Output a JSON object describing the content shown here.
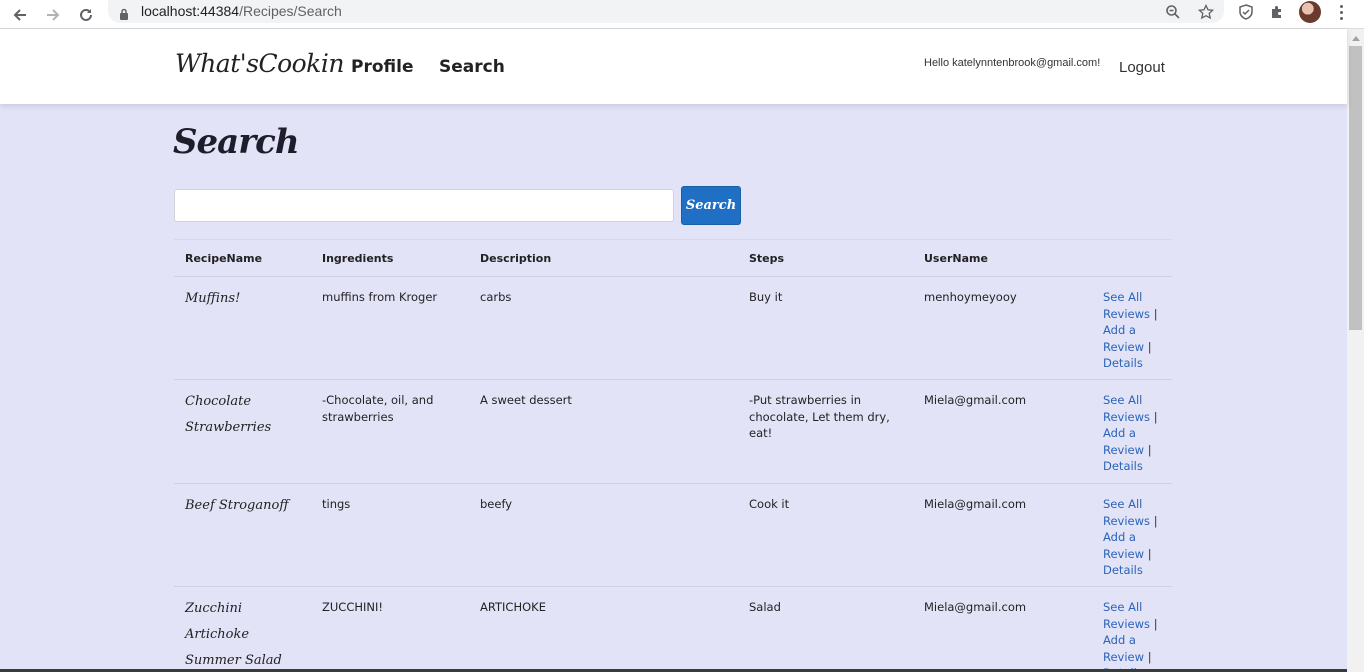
{
  "browser": {
    "url_host": "localhost:44384",
    "url_path": "/Recipes/Search"
  },
  "nav": {
    "brand": "What'sCookin",
    "links": [
      "Profile",
      "Search"
    ],
    "greeting": "Hello katelynntenbrook@gmail.com!",
    "logout": "Logout"
  },
  "page": {
    "title": "Search",
    "search_value": "",
    "search_button": "Search"
  },
  "table": {
    "headers": [
      "RecipeName",
      "Ingredients",
      "Description",
      "Steps",
      "UserName"
    ],
    "action_labels": {
      "see_all_1": "See All",
      "see_all_2": "Reviews",
      "add_1": "Add a",
      "add_2": "Review",
      "details": "Details",
      "sep": "|"
    },
    "rows": [
      {
        "name_lines": [
          "Muffins!"
        ],
        "ingredients": [
          "muffins from Kroger"
        ],
        "description": "carbs",
        "steps": [
          "Buy it"
        ],
        "user": "menhoymeyooy"
      },
      {
        "name_lines": [
          "Chocolate",
          "Strawberries"
        ],
        "ingredients": [
          "-Chocolate, oil, and",
          "strawberries"
        ],
        "description": "A sweet dessert",
        "steps": [
          "-Put strawberries in",
          "chocolate, Let them dry, eat!"
        ],
        "user": "Miela@gmail.com"
      },
      {
        "name_lines": [
          "Beef Stroganoff"
        ],
        "ingredients": [
          "tings"
        ],
        "description": "beefy",
        "steps": [
          "Cook it"
        ],
        "user": "Miela@gmail.com"
      },
      {
        "name_lines": [
          "Zucchini Artichoke",
          "Summer Salad"
        ],
        "ingredients": [
          "ZUCCHINI!"
        ],
        "description": "ARTICHOKE",
        "steps": [
          "Salad"
        ],
        "user": "Miela@gmail.com"
      }
    ]
  },
  "colors": {
    "page_bg": "#e3e3f8",
    "accent": "#1f6fc4",
    "link": "#2a64b8"
  }
}
